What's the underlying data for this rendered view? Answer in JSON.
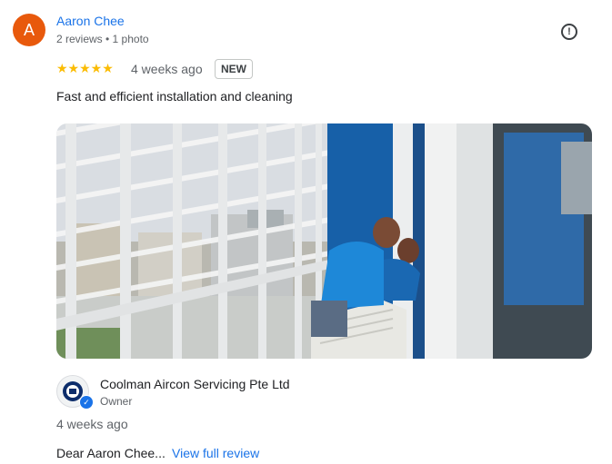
{
  "reviewer": {
    "initial": "A",
    "name": "Aaron Chee",
    "meta": "2 reviews • 1 photo",
    "avatar_color": "#e8590c"
  },
  "review": {
    "stars": "★★★★★",
    "rating": 5,
    "time": "4 weeks ago",
    "badge": "NEW",
    "text": "Fast and efficient installation and cleaning"
  },
  "owner": {
    "name": "Coolman Aircon Servicing Pte Ltd",
    "role": "Owner",
    "reply_time": "4 weeks ago",
    "reply_snippet": "Dear Aaron Chee...",
    "view_full": "View full review"
  },
  "colors": {
    "link": "#1a73e8",
    "star": "#fbbc04"
  },
  "icons": {
    "report": "report-icon",
    "verified": "verified-check-icon"
  }
}
